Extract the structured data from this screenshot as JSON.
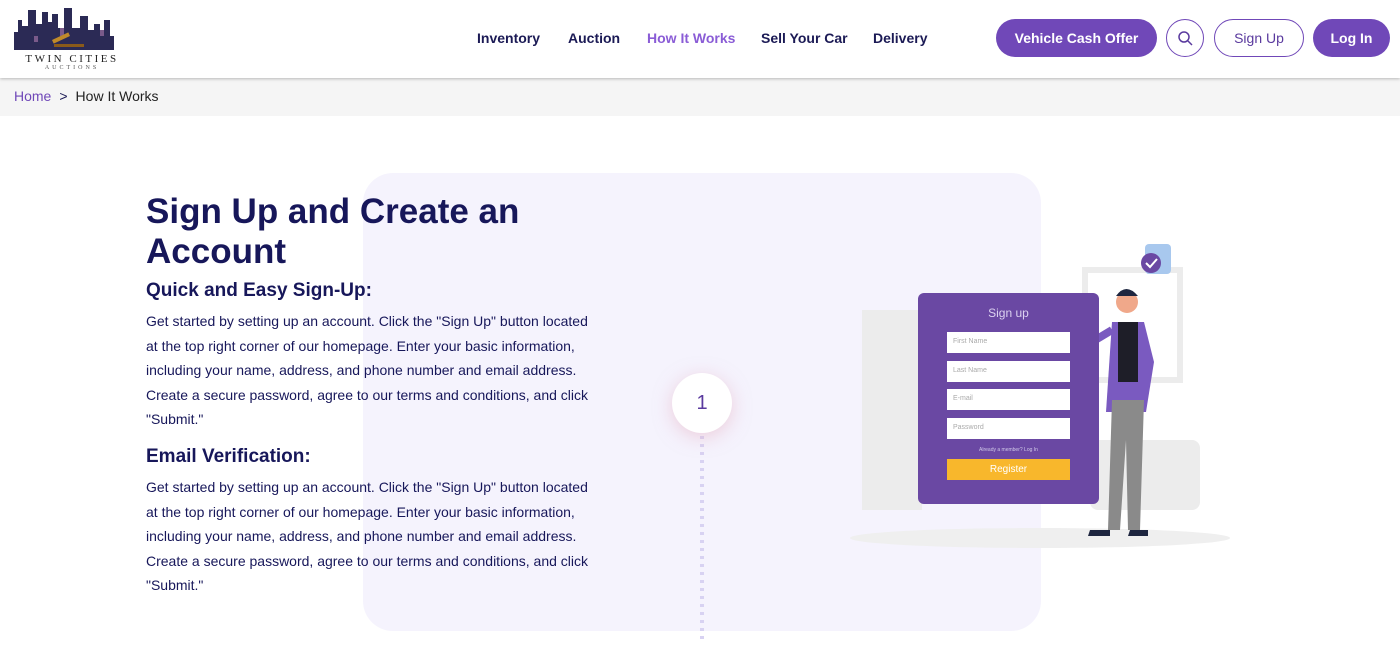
{
  "brand": {
    "line1": "TWIN CITIES",
    "line2": "AUCTIONS"
  },
  "nav": [
    {
      "label": "Inventory"
    },
    {
      "label": "Auction"
    },
    {
      "label": "How It Works",
      "active": true
    },
    {
      "label": "Sell Your Car"
    },
    {
      "label": "Delivery"
    }
  ],
  "actions": {
    "cash_offer": "Vehicle Cash Offer",
    "search_icon": "search-icon",
    "signup": "Sign Up",
    "login": "Log In"
  },
  "breadcrumb": {
    "home": "Home",
    "separator": ">",
    "current": "How It Works"
  },
  "main": {
    "title": "Sign Up and Create an Account",
    "sections": [
      {
        "heading": "Quick and Easy Sign-Up:",
        "text": "Get started by setting up an account. Click the \"Sign Up\" button located at the top right corner of our homepage. Enter your basic information, including your name, address, and phone number and email address. Create a secure password, agree to our terms and conditions, and click \"Submit.\""
      },
      {
        "heading": "Email Verification:",
        "text": "Get started by setting up an account. Click the \"Sign Up\" button located at the top right corner of our homepage. Enter your basic information, including your name, address, and phone number and email address. Create a secure password, agree to our terms and conditions, and click \"Submit.\""
      }
    ],
    "step_number": "1"
  },
  "illustration": {
    "title": "Sign up",
    "fields": [
      "First Name",
      "Last Name",
      "E-mail",
      "Password"
    ],
    "member_text": "Already a member? Log In",
    "register": "Register"
  },
  "colors": {
    "accent": "#7048b8",
    "navy": "#17175a",
    "card": "#f5f3fd",
    "register": "#f8b72c"
  }
}
